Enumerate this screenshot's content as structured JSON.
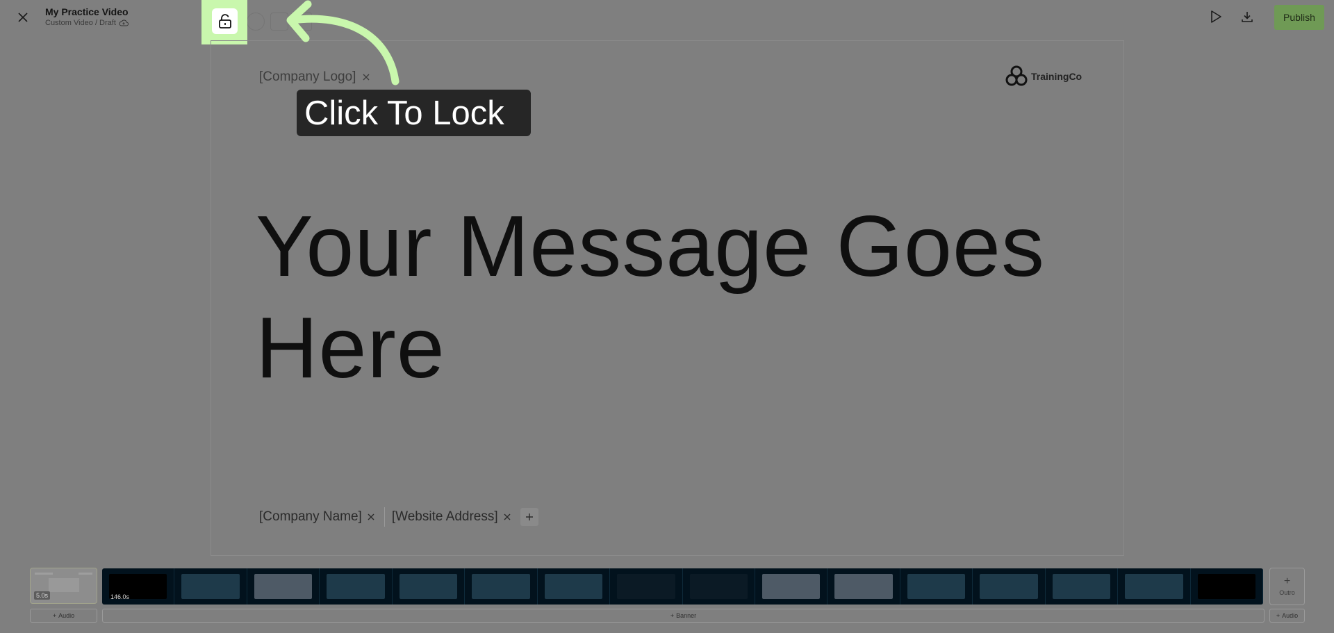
{
  "header": {
    "title": "My Practice Video",
    "subtitle": "Custom Video / Draft",
    "publish_label": "Publish"
  },
  "tooltip": {
    "text": "Click To Lock"
  },
  "canvas": {
    "logo_placeholder": "[Company Logo]",
    "brand_name": "TrainingCo",
    "headline": "Your Message Goes Here",
    "footer_fields": [
      "[Company Name]",
      "[Website Address]"
    ]
  },
  "timeline": {
    "intro_duration": "5.0s",
    "main_duration": "146.0s",
    "outro_label": "Outro",
    "audio_label": "Audio",
    "banner_label": "Banner"
  },
  "colors": {
    "lock_highlight": "#c9f7ad",
    "publish_bg": "#6f9a55",
    "overlay_bg": "#7f7f7f"
  },
  "icons": {
    "close": "close-icon",
    "cloud": "cloud-sync-icon",
    "lock": "unlock-icon",
    "play": "play-icon",
    "download": "download-icon",
    "arrow": "curved-arrow-icon",
    "brand": "trainingco-logo-icon"
  }
}
